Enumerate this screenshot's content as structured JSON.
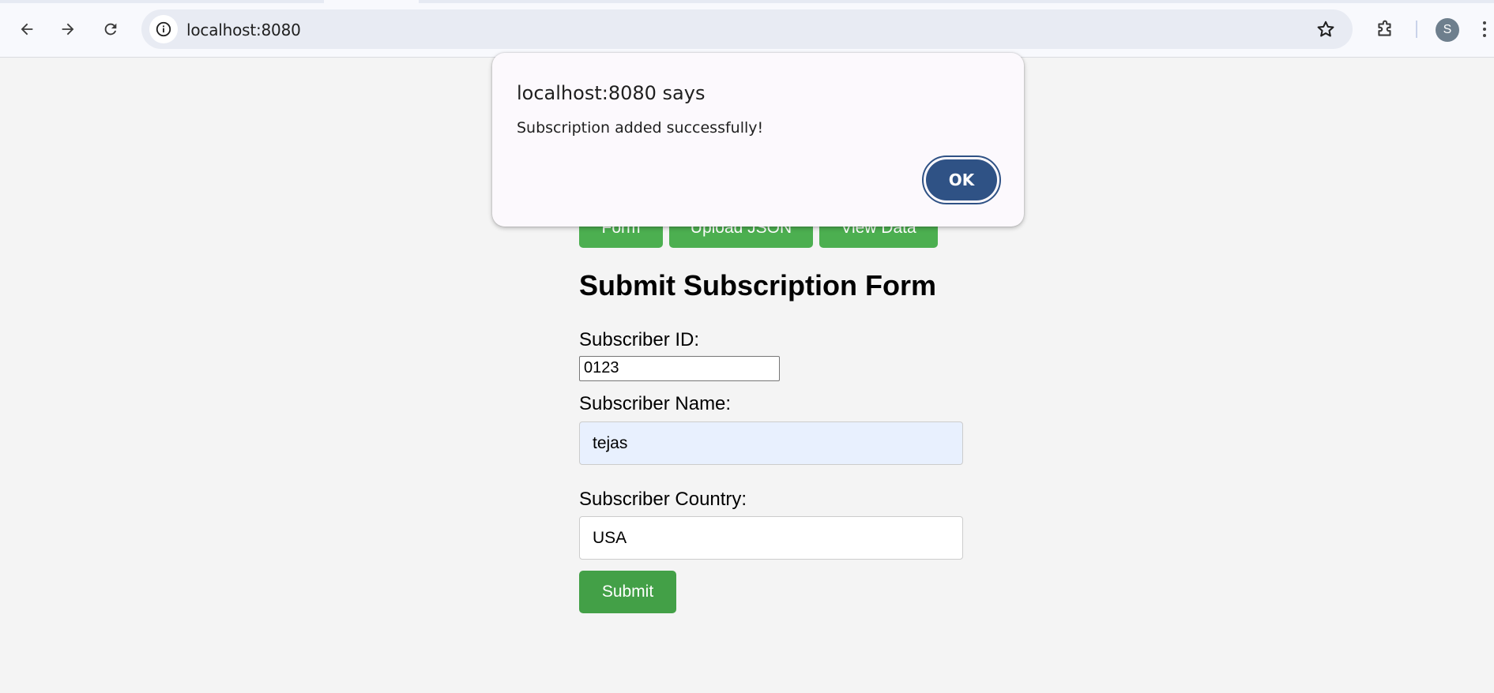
{
  "browser": {
    "url": "localhost:8080",
    "profile_initial": "S",
    "icons": {
      "back": "back-arrow-icon",
      "forward": "forward-arrow-icon",
      "reload": "reload-icon",
      "site_info": "info-icon",
      "bookmark": "star-icon",
      "extensions": "puzzle-icon",
      "menu": "kebab-menu-icon"
    }
  },
  "nav_buttons": {
    "form": "Form",
    "upload_json": "Upload JSON",
    "view_data": "View Data"
  },
  "form": {
    "title": "Submit Subscription Form",
    "id_label": "Subscriber ID:",
    "id_value": "0123",
    "name_label": "Subscriber Name:",
    "name_value": "tejas",
    "country_label": "Subscriber Country:",
    "country_value": "USA",
    "submit_label": "Submit"
  },
  "dialog": {
    "title": "localhost:8080 says",
    "message": "Subscription added successfully!",
    "ok_label": "OK"
  },
  "colors": {
    "green_button": "#4caf50",
    "submit_green": "#43a047",
    "dialog_button": "#2f5285",
    "autofill_bg": "#e8f0fe",
    "page_bg": "#f4f4f4"
  }
}
